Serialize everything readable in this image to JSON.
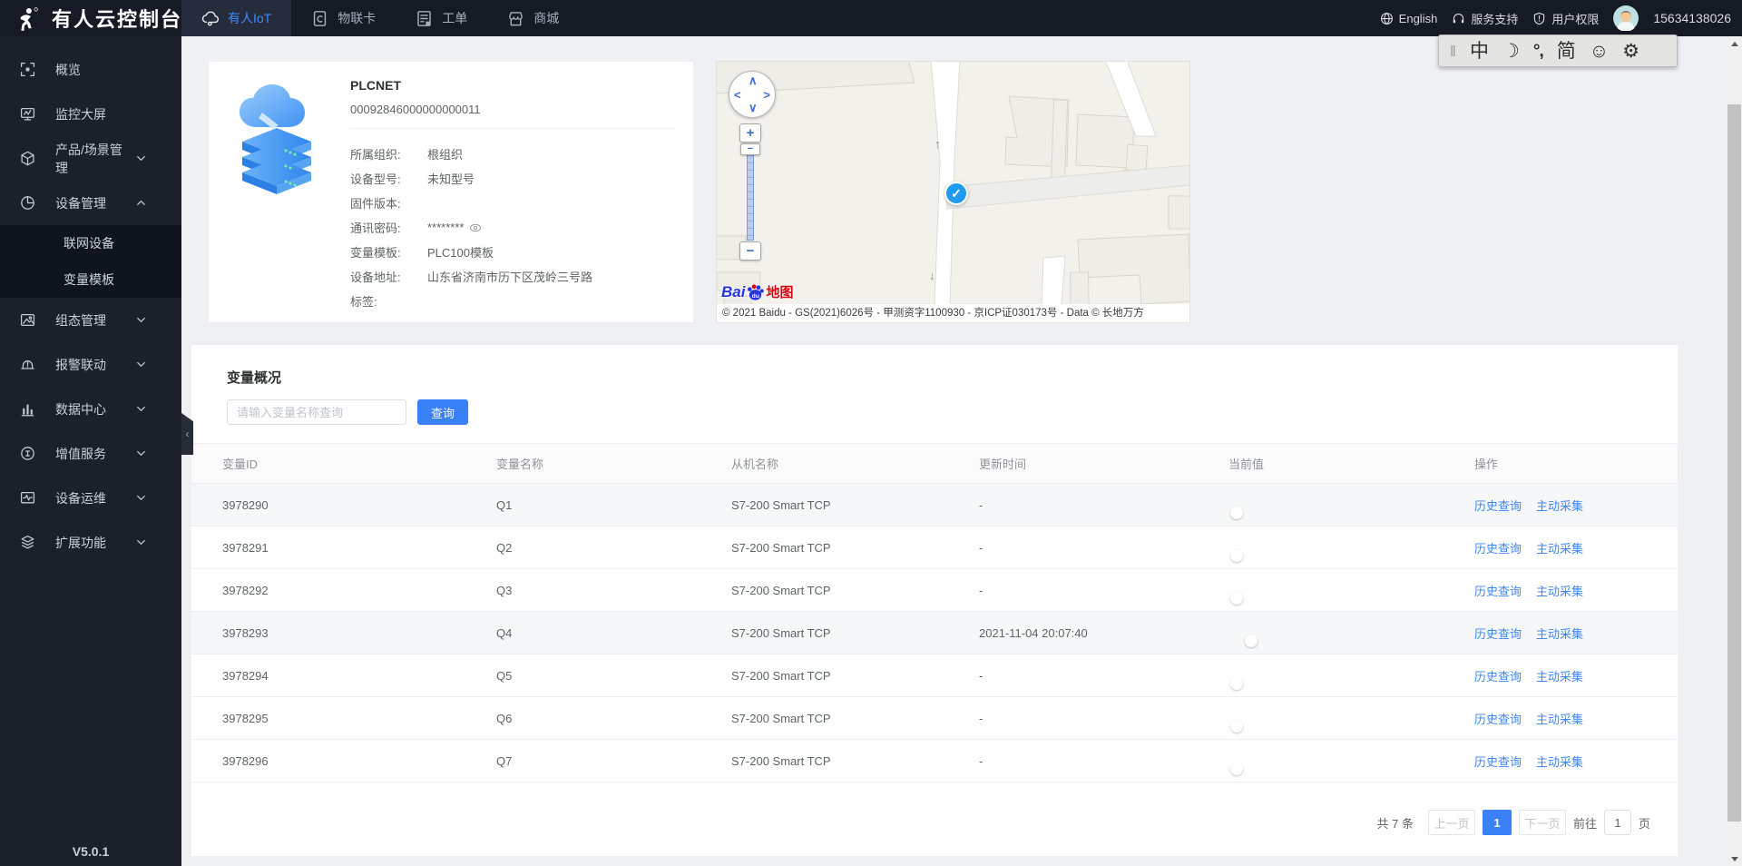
{
  "topbar": {
    "title": "有人云控制台",
    "tabs": [
      {
        "label": "有人IoT",
        "icon": "cloud",
        "active": true
      },
      {
        "label": "物联卡",
        "icon": "sim",
        "active": false
      },
      {
        "label": "工单",
        "icon": "workorder",
        "active": false
      },
      {
        "label": "商城",
        "icon": "mall",
        "active": false
      }
    ],
    "right_items": [
      {
        "label": "English",
        "icon": "globe"
      },
      {
        "label": "服务支持",
        "icon": "headset"
      },
      {
        "label": "用户权限",
        "icon": "shield"
      }
    ],
    "phone": "15634138026"
  },
  "ime_toolbar": {
    "items": [
      {
        "name": "drag-handle",
        "glyph": "‖"
      },
      {
        "name": "chinese-mode",
        "glyph": "中"
      },
      {
        "name": "moon-mode",
        "glyph": "☽"
      },
      {
        "name": "punctuation-mode",
        "glyph": "°,"
      },
      {
        "name": "simplified-chinese",
        "glyph": "简"
      },
      {
        "name": "emoji-picker",
        "glyph": "☺"
      },
      {
        "name": "settings",
        "glyph": "⚙"
      }
    ]
  },
  "sidebar": {
    "items": [
      {
        "label": "概览",
        "icon": "overview",
        "chevron": ""
      },
      {
        "label": "监控大屏",
        "icon": "screen",
        "chevron": ""
      },
      {
        "label": "产品/场景管理",
        "icon": "cube",
        "chevron": "down"
      },
      {
        "label": "设备管理",
        "icon": "pie",
        "chevron": "up",
        "children": [
          "联网设备",
          "变量模板"
        ]
      },
      {
        "label": "组态管理",
        "icon": "image",
        "chevron": "down"
      },
      {
        "label": "报警联动",
        "icon": "alarm",
        "chevron": "down"
      },
      {
        "label": "数据中心",
        "icon": "bars",
        "chevron": "down"
      },
      {
        "label": "增值服务",
        "icon": "service",
        "chevron": "down"
      },
      {
        "label": "设备运维",
        "icon": "ops",
        "chevron": "down"
      },
      {
        "label": "扩展功能",
        "icon": "layers",
        "chevron": "down"
      }
    ],
    "version": "V5.0.1"
  },
  "device": {
    "name": "PLCNET",
    "id": "00092846000000000011",
    "fields": [
      {
        "label": "所属组织:",
        "value": "根组织",
        "eye": false
      },
      {
        "label": "设备型号:",
        "value": "未知型号",
        "eye": false
      },
      {
        "label": "固件版本:",
        "value": "",
        "eye": false
      },
      {
        "label": "通讯密码:",
        "value": "********",
        "eye": true
      },
      {
        "label": "变量模板:",
        "value": "PLC100模板",
        "eye": false
      },
      {
        "label": "设备地址:",
        "value": "山东省济南市历下区茂岭三号路",
        "eye": false
      },
      {
        "label": "标签:",
        "value": "",
        "eye": false
      }
    ]
  },
  "map": {
    "attribution": "© 2021 Baidu - GS(2021)6026号 - 甲测资字1100930 - 京ICP证030173号 - Data © 长地万方",
    "logo": {
      "part1": "Bai",
      "part2": "地图"
    },
    "marker_glyph": "✓",
    "controls": {
      "zoom_in": "+",
      "zoom_out": "−",
      "handle": "−"
    },
    "arrows": {
      "up": "↑",
      "down": "↓"
    }
  },
  "variables": {
    "section_title": "变量概况",
    "search_placeholder": "请输入变量名称查询",
    "search_button": "查询",
    "table": {
      "columns": [
        "变量ID",
        "变量名称",
        "从机名称",
        "更新时间",
        "当前值",
        "操作"
      ],
      "action_labels": [
        "历史查询",
        "主动采集"
      ],
      "rows": [
        {
          "id": "3978290",
          "name": "Q1",
          "slave": "S7-200 Smart TCP",
          "updated": "-",
          "on": false,
          "shaded": true
        },
        {
          "id": "3978291",
          "name": "Q2",
          "slave": "S7-200 Smart TCP",
          "updated": "-",
          "on": false,
          "shaded": false
        },
        {
          "id": "3978292",
          "name": "Q3",
          "slave": "S7-200 Smart TCP",
          "updated": "-",
          "on": false,
          "shaded": false
        },
        {
          "id": "3978293",
          "name": "Q4",
          "slave": "S7-200 Smart TCP",
          "updated": "2021-11-04 20:07:40",
          "on": true,
          "shaded": true
        },
        {
          "id": "3978294",
          "name": "Q5",
          "slave": "S7-200 Smart TCP",
          "updated": "-",
          "on": false,
          "shaded": false
        },
        {
          "id": "3978295",
          "name": "Q6",
          "slave": "S7-200 Smart TCP",
          "updated": "-",
          "on": false,
          "shaded": false
        },
        {
          "id": "3978296",
          "name": "Q7",
          "slave": "S7-200 Smart TCP",
          "updated": "-",
          "on": false,
          "shaded": false
        }
      ]
    },
    "pagination": {
      "total": "共 7 条",
      "prev": "上一页",
      "current": "1",
      "next": "下一页",
      "jump_prefix": "前往",
      "jump_value": "1",
      "jump_suffix": "页"
    }
  },
  "colors": {
    "accent_blue": "#3a80f7",
    "toggle_on": "#47a3f9",
    "topbar_bg": "#161a24",
    "sidebar_bg": "#1b202b"
  }
}
